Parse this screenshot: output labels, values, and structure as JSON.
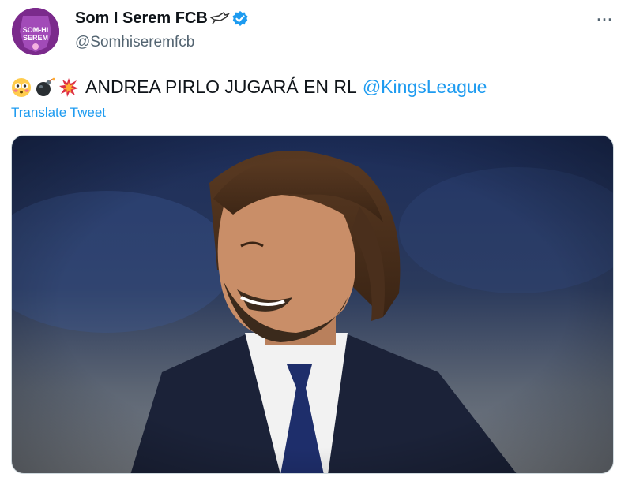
{
  "tweet": {
    "display_name": "Som I Serem FCB",
    "handle": "@Somhiseremfcb",
    "avatar_text": [
      "SOM-HI",
      "SEREM"
    ],
    "text": "ANDREA PIRLO JUGARÁ EN RL",
    "mention": "@KingsLeague",
    "translate_label": "Translate Tweet",
    "more_label": "···",
    "emojis": [
      "flushed-face-emoji",
      "bomb-emoji",
      "collision-emoji"
    ],
    "media": "photo of a smiling bearded man in a dark suit and navy tie"
  },
  "colors": {
    "link": "#1d9bf0",
    "verified": "#1d9bf0",
    "avatar_bg": "#7b2a8c",
    "secondary_text": "#536471"
  }
}
